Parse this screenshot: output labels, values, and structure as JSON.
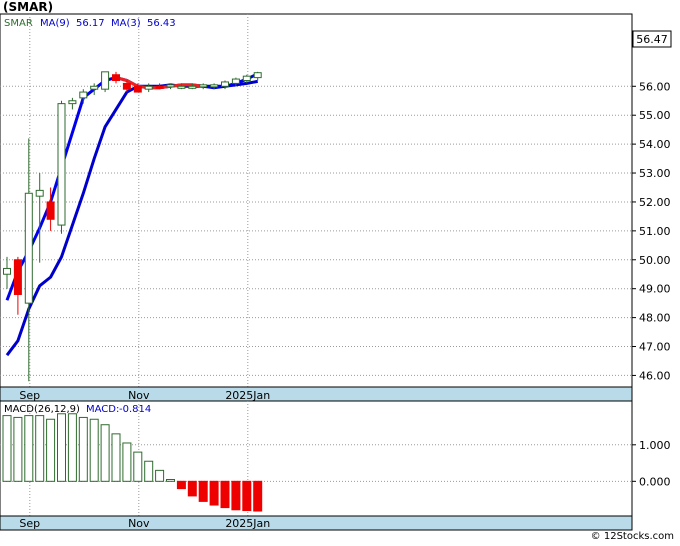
{
  "title": "(SMAR)",
  "footer": "© 12Stocks.com",
  "colors": {
    "up": "#2e6b2e",
    "down": "#ee0000",
    "ma9": "#0000cc",
    "ma3": "#0000ee",
    "ma3_down": "#ee2222",
    "grid": "#9a9a9a",
    "axis_band": "#b9dbe9"
  },
  "chart_data": [
    {
      "type": "candlestick",
      "ticker": "SMAR",
      "legend": {
        "symbol": "SMAR",
        "ma9_label": "MA(9)",
        "ma9_value": "56.17",
        "ma3_label": "MA(3)",
        "ma3_value": "56.43"
      },
      "last_price_label": "56.47",
      "ylim": [
        45.6,
        58.5
      ],
      "y_ticks": [
        "46.00",
        "47.00",
        "48.00",
        "49.00",
        "50.00",
        "51.00",
        "52.00",
        "53.00",
        "54.00",
        "55.00",
        "56.00"
      ],
      "x_ticks": [
        "Sep",
        "Nov",
        "2025Jan"
      ],
      "candles": [
        {
          "o": 49.5,
          "h": 50.1,
          "l": 49.0,
          "c": 49.7
        },
        {
          "o": 50.0,
          "h": 50.1,
          "l": 48.1,
          "c": 48.8
        },
        {
          "o": 48.5,
          "h": 54.2,
          "l": 45.8,
          "c": 52.3
        },
        {
          "o": 52.2,
          "h": 53.0,
          "l": 49.9,
          "c": 52.4
        },
        {
          "o": 52.0,
          "h": 52.5,
          "l": 51.0,
          "c": 51.4
        },
        {
          "o": 51.2,
          "h": 55.5,
          "l": 50.9,
          "c": 55.4
        },
        {
          "o": 55.4,
          "h": 55.6,
          "l": 55.2,
          "c": 55.5
        },
        {
          "o": 55.6,
          "h": 55.9,
          "l": 55.4,
          "c": 55.8
        },
        {
          "o": 55.9,
          "h": 56.1,
          "l": 55.7,
          "c": 56.0
        },
        {
          "o": 55.9,
          "h": 56.5,
          "l": 55.8,
          "c": 56.5
        },
        {
          "o": 56.4,
          "h": 56.5,
          "l": 56.1,
          "c": 56.2
        },
        {
          "o": 56.1,
          "h": 56.2,
          "l": 55.8,
          "c": 55.9
        },
        {
          "o": 56.0,
          "h": 56.1,
          "l": 55.8,
          "c": 55.8
        },
        {
          "o": 55.9,
          "h": 56.1,
          "l": 55.8,
          "c": 56.0
        },
        {
          "o": 56.0,
          "h": 56.1,
          "l": 55.9,
          "c": 55.95
        },
        {
          "o": 56.0,
          "h": 56.1,
          "l": 55.9,
          "c": 56.05
        },
        {
          "o": 56.0,
          "h": 56.1,
          "l": 55.9,
          "c": 56.0
        },
        {
          "o": 56.0,
          "h": 56.1,
          "l": 55.9,
          "c": 56.0
        },
        {
          "o": 56.0,
          "h": 56.1,
          "l": 55.9,
          "c": 56.05
        },
        {
          "o": 56.0,
          "h": 56.1,
          "l": 55.9,
          "c": 56.05
        },
        {
          "o": 56.0,
          "h": 56.2,
          "l": 55.9,
          "c": 56.15
        },
        {
          "o": 56.1,
          "h": 56.3,
          "l": 56.0,
          "c": 56.25
        },
        {
          "o": 56.2,
          "h": 56.4,
          "l": 56.1,
          "c": 56.35
        },
        {
          "o": 56.3,
          "h": 56.5,
          "l": 56.2,
          "c": 56.47
        }
      ],
      "ma9": [
        46.7,
        47.2,
        48.3,
        49.1,
        49.4,
        50.1,
        51.2,
        52.3,
        53.5,
        54.6,
        55.2,
        55.8,
        56.0,
        56.0,
        56.0,
        56.05,
        56.0,
        56.0,
        56.0,
        56.0,
        56.0,
        56.05,
        56.1,
        56.17
      ],
      "ma3": [
        48.6,
        49.6,
        50.3,
        51.1,
        52.0,
        53.2,
        54.4,
        55.6,
        55.9,
        56.2,
        56.3,
        56.2,
        56.0,
        55.95,
        55.95,
        56.0,
        56.05,
        56.05,
        56.0,
        55.95,
        56.0,
        56.1,
        56.25,
        56.43
      ],
      "ma3_down_from": 10,
      "ma3_down_to": 18
    },
    {
      "type": "bar",
      "legend": {
        "label": "MACD(26,12,9)",
        "macd_label": "MACD:",
        "macd_value": "-0.814"
      },
      "ylim": [
        -0.95,
        2.2
      ],
      "y_ticks": [
        "0.000",
        "1.000"
      ],
      "x_ticks": [
        "Sep",
        "Nov",
        "2025Jan"
      ],
      "values": [
        1.8,
        1.75,
        1.8,
        1.8,
        1.7,
        1.85,
        1.85,
        1.75,
        1.7,
        1.55,
        1.3,
        1.05,
        0.8,
        0.55,
        0.3,
        0.05,
        -0.2,
        -0.4,
        -0.55,
        -0.65,
        -0.72,
        -0.78,
        -0.8,
        -0.814
      ]
    }
  ]
}
